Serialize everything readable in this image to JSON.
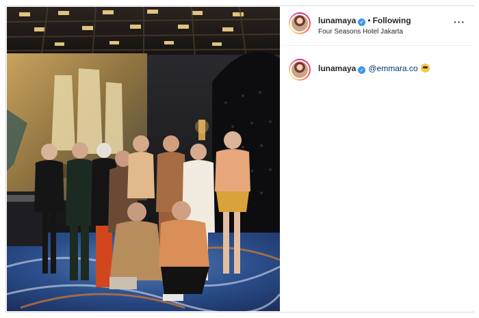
{
  "post": {
    "photo_alt": "",
    "username": "lunamaya",
    "verified_mark": "✓",
    "separator": "•",
    "follow_status": "Following",
    "location": "Four Seasons Hotel Jakarta",
    "more_label": "···"
  },
  "caption": {
    "username": "lunamaya",
    "verified_mark": "✓",
    "mention": "@emmara.co"
  },
  "icons": {
    "verified": "verified-badge-icon",
    "more": "more-options-icon",
    "emoji": "smiling-face-emoji-icon"
  },
  "colors": {
    "verified": "#3897f0",
    "mention": "#00376b",
    "text": "#262626"
  }
}
